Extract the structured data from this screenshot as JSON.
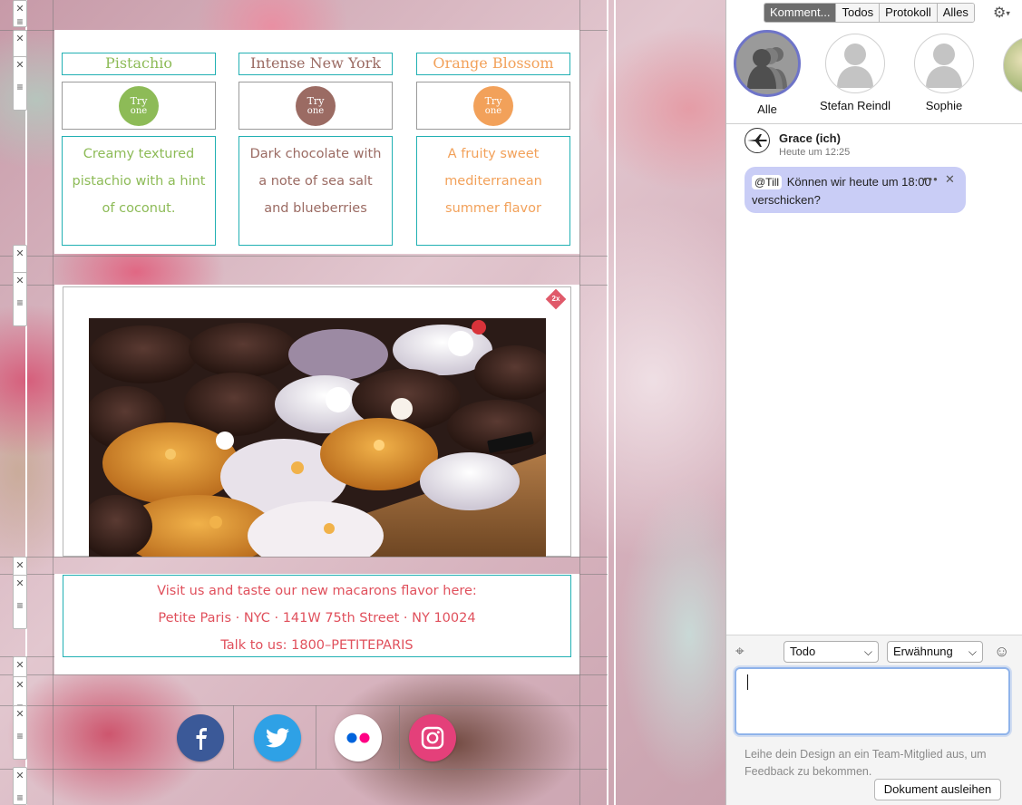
{
  "flavors": [
    {
      "title": "Pistachio",
      "badge_line1": "Try",
      "badge_line2": "one",
      "description": "Creamy textured pistachio with a hint of coconut.",
      "color": "#8dbb57"
    },
    {
      "title": "Intense New York",
      "badge_line1": "Try",
      "badge_line2": "one",
      "description": "Dark chocolate with a note of sea salt and blueberries",
      "color": "#9b6b63"
    },
    {
      "title": "Orange Blossom",
      "badge_line1": "Try",
      "badge_line2": "one",
      "description": "A fruity sweet mediterranean summer flavor",
      "color": "#f2a15a"
    }
  ],
  "image_badge": "2x",
  "visit": {
    "line1": "Visit us and taste our new macarons flavor here:",
    "line2": "Petite Paris · NYC · 141W 75th Street · NY 10024",
    "line3": "Talk to us: 1800–PETITEPARIS",
    "color": "#e0505c"
  },
  "social": [
    {
      "icon": "facebook-icon",
      "color": "#3b5998"
    },
    {
      "icon": "twitter-icon",
      "color": "#2ea1e6"
    },
    {
      "icon": "flickr-icon",
      "color": "#ffffff"
    },
    {
      "icon": "instagram-icon",
      "color": "#e4407a"
    }
  ],
  "sidebar": {
    "tabs": [
      "Komment...",
      "Todos",
      "Protokoll",
      "Alles"
    ],
    "active_tab": "Komment...",
    "people": [
      "Alle",
      "Stefan Reindl",
      "Sophie"
    ],
    "comment": {
      "author": "Grace",
      "author_suffix": "(ich)",
      "time": "Heute um 12:25",
      "mention": "@Till",
      "text": "Können wir heute um 18:00 verschicken?"
    },
    "type_select": "Todo",
    "mention_select": "Erwähnung",
    "hint": "Leihe dein Design an ein Team-Mitglied aus, um Feedback zu bekommen.",
    "lend_button": "Dokument ausleihen",
    "accent_color": "#6e74c8",
    "bubble_color": "#c9cdf6"
  }
}
